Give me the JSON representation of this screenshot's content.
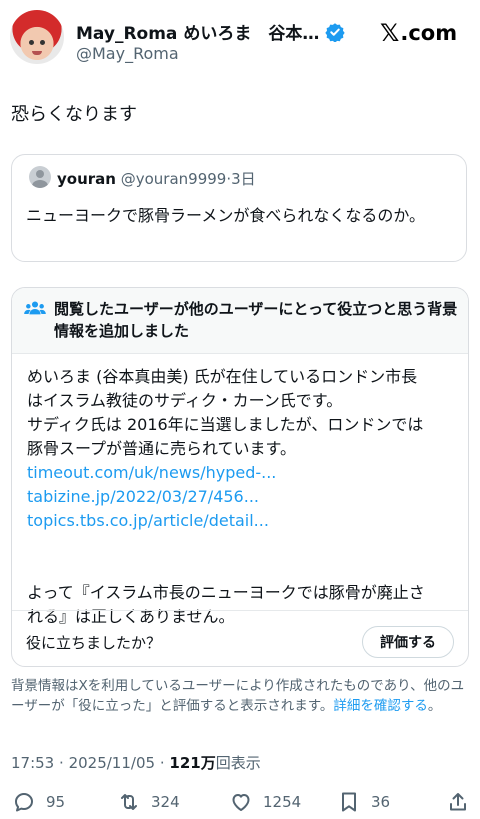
{
  "author": {
    "display_name": "May_Roma めいろま　谷本…",
    "handle": "@May_Roma",
    "verified_color": "#1d9bf0"
  },
  "brand": {
    "logo_x": "𝕏",
    "logo_text": ".com"
  },
  "post": {
    "text": "恐らくなります"
  },
  "quote": {
    "name": "youran",
    "handle": "@youran9999",
    "sep": "·",
    "time": "3日",
    "text": "ニューヨークで豚骨ラーメンが食べられなくなるのか。"
  },
  "note": {
    "title": "閲覧したユーザーが他のユーザーにとって役立つと思う背景情報を追加しました",
    "lines": [
      "めいろま (谷本真由美) 氏が在住しているロンドン市長",
      "はイスラム教徒のサディク・カーン氏です。",
      "サディク氏は 2016年に当選しましたが、ロンドンでは",
      "豚骨スープが普通に売られています。"
    ],
    "links": [
      "timeout.com/uk/news/hyped-...",
      "tabizine.jp/2022/03/27/456...",
      "topics.tbs.co.jp/article/detail..."
    ],
    "conclusion_lines": [
      "よって『イスラム市長のニューヨークでは豚骨が廃止さ",
      "れる』は正しくありません。"
    ],
    "helpful_question": "役に立ちましたか？",
    "rate_button": "評価する"
  },
  "disclaimer": {
    "text": "背景情報はXを利用しているユーザーにより作成されたものであり、他のユーザーが「役に立った」と評価すると表示されます。",
    "more_link": "詳細を確認する",
    "end": "。"
  },
  "meta": {
    "time": "17:53",
    "sep": "·",
    "date": "2025/11/05",
    "views_count": "121万",
    "views_label": "回表示"
  },
  "actions": {
    "replies": "95",
    "reposts": "324",
    "likes": "1254",
    "bookmarks": "36"
  }
}
